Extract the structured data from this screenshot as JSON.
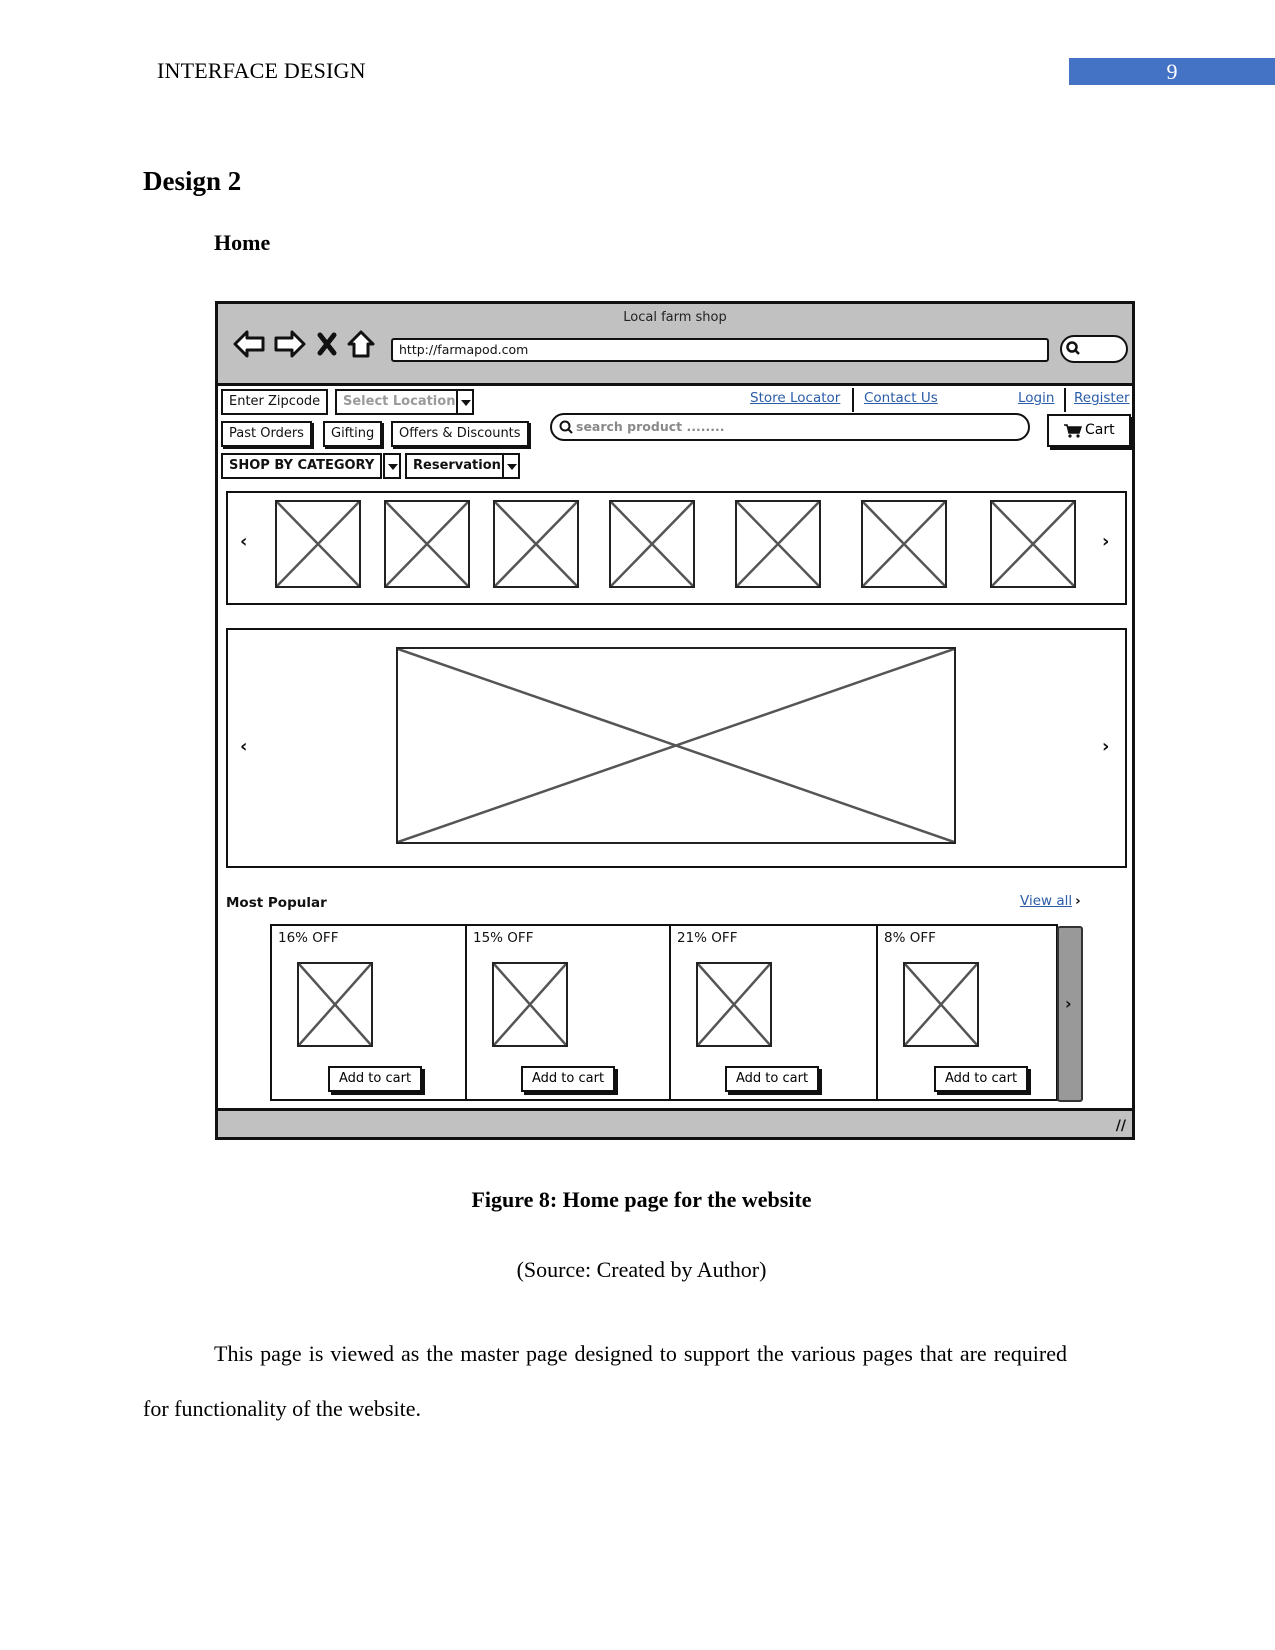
{
  "document": {
    "running_head": "INTERFACE DESIGN",
    "page_number": "9",
    "heading": "Design 2",
    "subheading": "Home",
    "figure_caption": "Figure 8: Home page for the website",
    "figure_source": "(Source: Created by Author)",
    "paragraph": "This page is viewed as the master page designed to support the various pages that are required for functionality of the website."
  },
  "wireframe": {
    "window_title": "Local farm shop",
    "nav_icons": [
      "back-arrow-icon",
      "forward-arrow-icon",
      "stop-icon",
      "home-icon"
    ],
    "url": "http://farmapod.com",
    "zipcode_button": "Enter Zipcode",
    "location_select": {
      "selected": "Select Location"
    },
    "top_links": {
      "store_locator": "Store Locator",
      "contact_us": "Contact Us",
      "login": "Login",
      "register": "Register"
    },
    "menu_buttons": [
      "Past Orders",
      "Gifting",
      "Offers & Discounts"
    ],
    "search": {
      "placeholder": "search product ........"
    },
    "cart_label": "Cart",
    "category_select": {
      "selected": "SHOP BY CATEGORY"
    },
    "reservation_select": {
      "selected": "Reservation"
    },
    "category_carousel": {
      "item_count": 7,
      "prev": "‹",
      "next": "›"
    },
    "hero_carousel": {
      "prev": "‹",
      "next": "›"
    },
    "most_popular": {
      "title": "Most Popular",
      "view_all": "View all",
      "view_all_chevron": "›",
      "next": "›",
      "products": [
        {
          "discount": "16% OFF",
          "button": "Add to cart"
        },
        {
          "discount": "15% OFF",
          "button": "Add to cart"
        },
        {
          "discount": "21% OFF",
          "button": "Add to cart"
        },
        {
          "discount": "8% OFF",
          "button": "Add to cart"
        }
      ]
    },
    "colors": {
      "chrome": "#c1c1c1",
      "link": "#2a5ca8",
      "page_badge": "#4472c4"
    }
  }
}
